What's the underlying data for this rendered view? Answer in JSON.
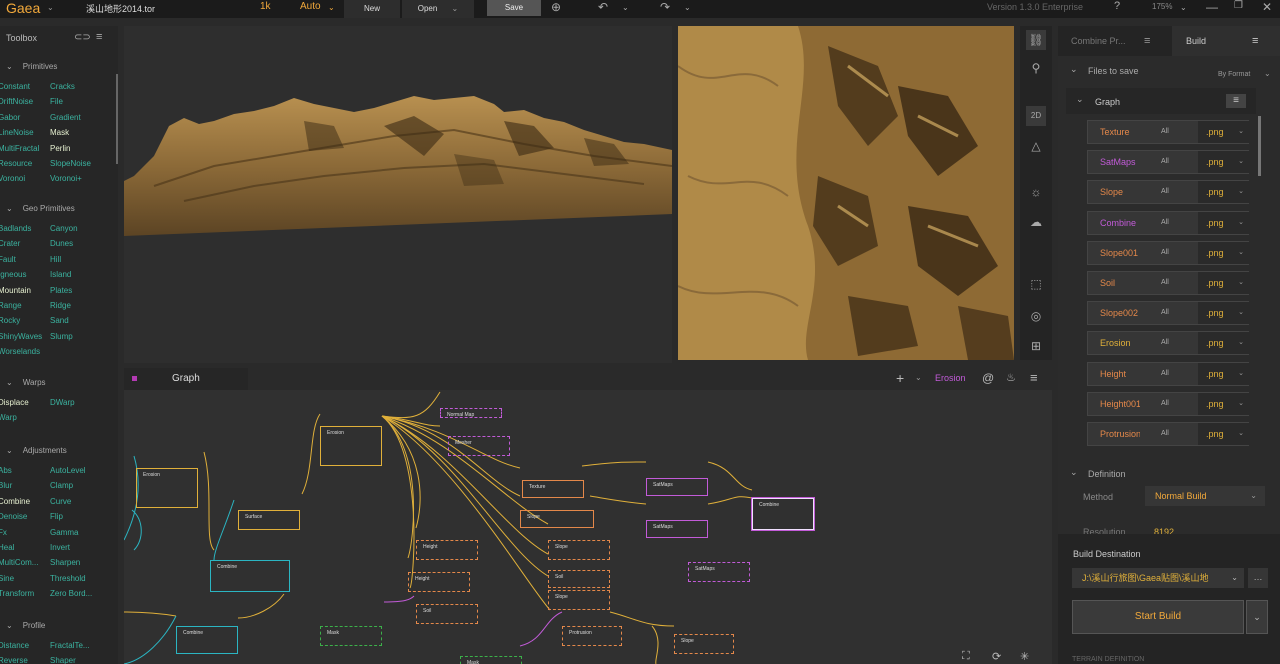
{
  "titlebar": {
    "app": "Gaea",
    "file": "溪山地形2014.tor",
    "resolution": "1k",
    "mode": "Auto",
    "new": "New",
    "open": "Open",
    "save": "Save",
    "version": "Version 1.3.0 Enterprise",
    "zoom": "175%"
  },
  "toolbox": {
    "title": "Toolbox",
    "sections": [
      {
        "title": "Primitives",
        "items": [
          "Constant",
          "Cracks",
          "DriftNoise",
          "File",
          "Gabor",
          "Gradient",
          "LineNoise",
          "Mask",
          "MultiFractal",
          "Perlin",
          "Resource",
          "SlopeNoise",
          "Voronoi",
          "Voronoi+"
        ]
      },
      {
        "title": "Geo Primitives",
        "items": [
          "Badlands",
          "Canyon",
          "Crater",
          "Dunes",
          "Fault",
          "Hill",
          "Igneous",
          "Island",
          "Mountain",
          "Plates",
          "Range",
          "Ridge",
          "Rocky",
          "Sand",
          "ShinyWaves",
          "Slump",
          "Worselands"
        ]
      },
      {
        "title": "Warps",
        "items": [
          "Displace",
          "DWarp",
          "Warp"
        ]
      },
      {
        "title": "Adjustments",
        "items": [
          "Abs",
          "AutoLevel",
          "Blur",
          "Clamp",
          "Combine",
          "Curve",
          "Denoise",
          "Flip",
          "Fx",
          "Gamma",
          "Heal",
          "Invert",
          "MultiCom...",
          "Sharpen",
          "Sine",
          "Threshold",
          "Transform",
          "Zero Bord..."
        ]
      },
      {
        "title": "Profile",
        "items": [
          "Distance",
          "FractalTe...",
          "Reverse",
          "Shaper"
        ]
      }
    ]
  },
  "graph": {
    "tab": "Graph",
    "active_node": "Erosion",
    "nodes": [
      "Erosion",
      "Erosion",
      "Surface",
      "Combine",
      "Combine",
      "Normal Map",
      "Mesher",
      "Texture",
      "Slope",
      "Slope",
      "Soil",
      "Slope",
      "Height",
      "Height",
      "Soil",
      "Mask",
      "Mask",
      "Protrusion",
      "Slope",
      "SatMaps",
      "SatMaps",
      "SatMaps",
      "Combine"
    ]
  },
  "rightpanel": {
    "tab_a": "Combine Pr...",
    "tab_b": "Build",
    "files_to_save": "Files to save",
    "by_format": "By Format",
    "graph_label": "Graph",
    "rows": [
      {
        "name": "Texture",
        "scope": "All",
        "format": ".png",
        "color": "#e4884a"
      },
      {
        "name": "SatMaps",
        "scope": "All",
        "format": ".png",
        "color": "#c25bd8"
      },
      {
        "name": "Slope",
        "scope": "All",
        "format": ".png",
        "color": "#e4884a"
      },
      {
        "name": "Combine",
        "scope": "All",
        "format": ".png",
        "color": "#c25bd8"
      },
      {
        "name": "Slope001",
        "scope": "All",
        "format": ".png",
        "color": "#e4884a"
      },
      {
        "name": "Soil",
        "scope": "All",
        "format": ".png",
        "color": "#e4884a"
      },
      {
        "name": "Slope002",
        "scope": "All",
        "format": ".png",
        "color": "#e4884a"
      },
      {
        "name": "Erosion",
        "scope": "All",
        "format": ".png",
        "color": "#e0b03a"
      },
      {
        "name": "Height",
        "scope": "All",
        "format": ".png",
        "color": "#e4884a"
      },
      {
        "name": "Height001",
        "scope": "All",
        "format": ".png",
        "color": "#e4884a"
      },
      {
        "name": "Protrusion",
        "scope": "All",
        "format": ".png",
        "color": "#e4884a"
      }
    ],
    "definition": "Definition",
    "method_label": "Method",
    "method_value": "Normal Build",
    "resolution_label": "Resolution",
    "resolution_value": "8192",
    "build_destination": "Build Destination",
    "destination_path": "J:\\溪山行旅图\\Gaea贴图\\溪山地",
    "start_build": "Start Build",
    "terrain_definition": "TERRAIN DEFINITION"
  }
}
